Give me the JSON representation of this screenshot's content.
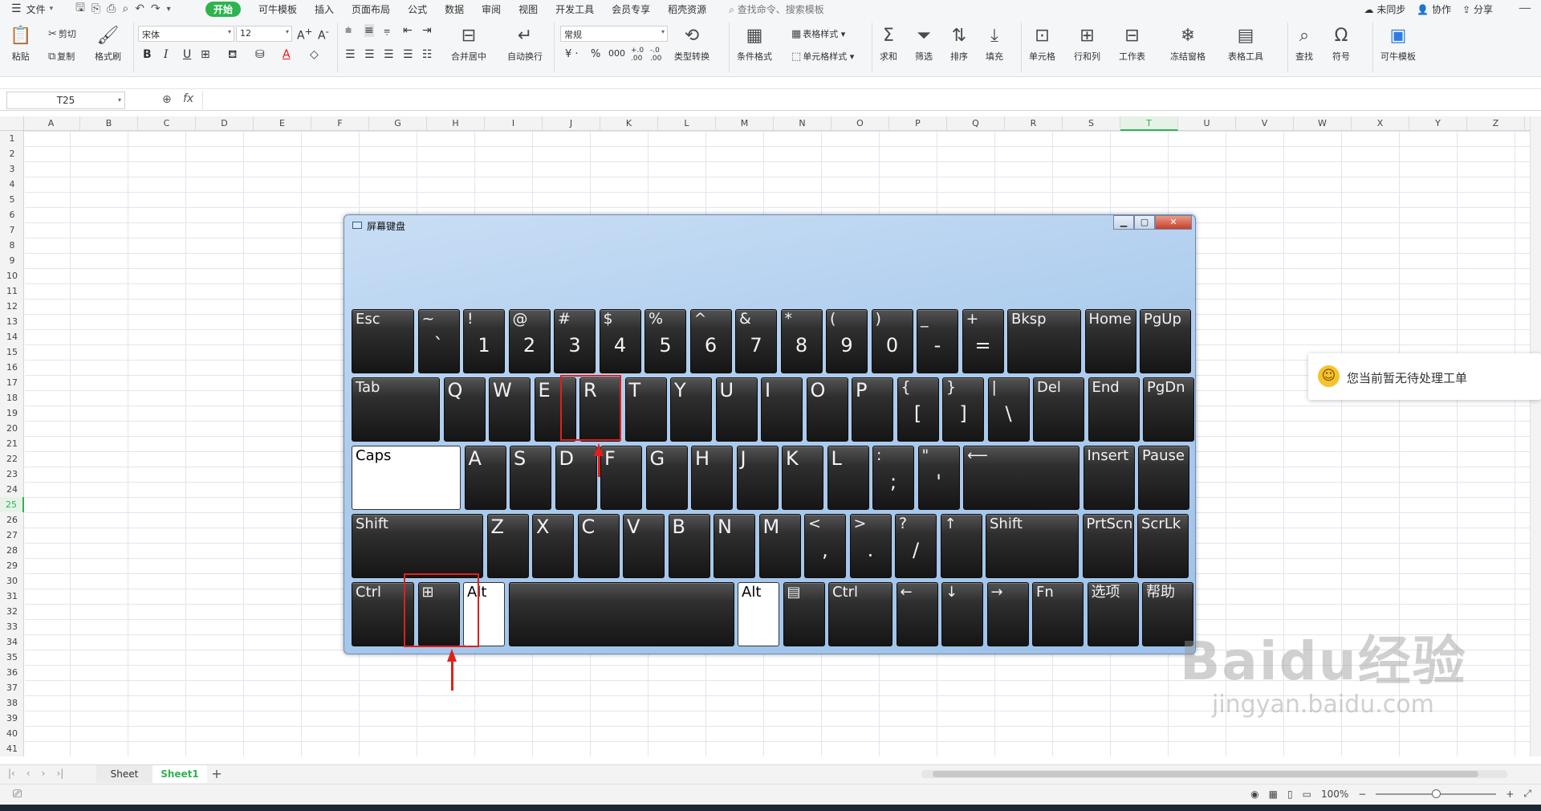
{
  "menu": {
    "file_label": "文件",
    "tabs": [
      "开始",
      "可牛模板",
      "插入",
      "页面布局",
      "公式",
      "数据",
      "审阅",
      "视图",
      "开发工具",
      "会员专享",
      "稻壳资源"
    ],
    "search_label": "查找命令、搜索模板",
    "right": [
      "未同步",
      "协作",
      "分享"
    ]
  },
  "ribbon": {
    "paste": "粘贴",
    "cut": "剪切",
    "copy": "复制",
    "format_painter": "格式刷",
    "font_name": "宋体",
    "font_size": "12",
    "merge_center": "合并居中",
    "wrap_text": "自动换行",
    "number_format": "常规",
    "type_convert": "类型转换",
    "cond_format": "条件格式",
    "table_style": "表格样式",
    "cell_style": "单元格样式",
    "sum": "求和",
    "filter": "筛选",
    "sort": "排序",
    "fill": "填充",
    "cell": "单元格",
    "row_col": "行和列",
    "worksheet": "工作表",
    "freeze": "冻结窗格",
    "table_tools": "表格工具",
    "find": "查找",
    "symbol": "符号",
    "kn_template": "可牛模板"
  },
  "formula": {
    "name_box": "T25",
    "fx": "fx",
    "value": ""
  },
  "grid": {
    "columns": [
      "A",
      "B",
      "C",
      "D",
      "E",
      "F",
      "G",
      "H",
      "I",
      "J",
      "K",
      "L",
      "M",
      "N",
      "O",
      "P",
      "Q",
      "R",
      "S",
      "T",
      "U",
      "V",
      "W",
      "X",
      "Y",
      "Z"
    ],
    "selected_column": "T",
    "selected_row": "25",
    "rows": [
      "1",
      "2",
      "3",
      "4",
      "5",
      "6",
      "7",
      "8",
      "9",
      "10",
      "11",
      "12",
      "13",
      "14",
      "15",
      "16",
      "17",
      "18",
      "19",
      "20",
      "21",
      "22",
      "23",
      "24",
      "25",
      "26",
      "27",
      "28",
      "29",
      "30",
      "31",
      "32",
      "33",
      "34",
      "35",
      "36",
      "37",
      "38",
      "39",
      "40",
      "41"
    ]
  },
  "sheets": {
    "tabs": [
      "Sheet",
      "Sheet1"
    ],
    "active": "Sheet1",
    "add": "+"
  },
  "status": {
    "zoom": "100%"
  },
  "notification": {
    "text": "您当前暂无待处理工单"
  },
  "osk": {
    "title": "屏幕键盘",
    "rows": [
      [
        {
          "t": "Esc",
          "b": ""
        },
        {
          "t": "~",
          "b": "`"
        },
        {
          "t": "!",
          "b": "1"
        },
        {
          "t": "@",
          "b": "2"
        },
        {
          "t": "#",
          "b": "3"
        },
        {
          "t": "$",
          "b": "4"
        },
        {
          "t": "%",
          "b": "5"
        },
        {
          "t": "^",
          "b": "6"
        },
        {
          "t": "&",
          "b": "7"
        },
        {
          "t": "*",
          "b": "8"
        },
        {
          "t": "(",
          "b": "9"
        },
        {
          "t": ")",
          "b": "0"
        },
        {
          "t": "_",
          "b": "-"
        },
        {
          "t": "+",
          "b": "="
        },
        {
          "t": "Bksp",
          "b": ""
        },
        {
          "t": "Home",
          "b": ""
        },
        {
          "t": "PgUp",
          "b": ""
        }
      ],
      [
        {
          "t": "Tab",
          "b": ""
        },
        {
          "t": "Q",
          "b": ""
        },
        {
          "t": "W",
          "b": ""
        },
        {
          "t": "E",
          "b": ""
        },
        {
          "t": "R",
          "b": ""
        },
        {
          "t": "T",
          "b": ""
        },
        {
          "t": "Y",
          "b": ""
        },
        {
          "t": "U",
          "b": ""
        },
        {
          "t": "I",
          "b": ""
        },
        {
          "t": "O",
          "b": ""
        },
        {
          "t": "P",
          "b": ""
        },
        {
          "t": "{",
          "b": "["
        },
        {
          "t": "}",
          "b": "]"
        },
        {
          "t": "|",
          "b": "\\"
        },
        {
          "t": "Del",
          "b": ""
        },
        {
          "t": "End",
          "b": ""
        },
        {
          "t": "PgDn",
          "b": ""
        }
      ],
      [
        {
          "t": "Caps",
          "b": ""
        },
        {
          "t": "A",
          "b": ""
        },
        {
          "t": "S",
          "b": ""
        },
        {
          "t": "D",
          "b": ""
        },
        {
          "t": "F",
          "b": ""
        },
        {
          "t": "G",
          "b": ""
        },
        {
          "t": "H",
          "b": ""
        },
        {
          "t": "J",
          "b": ""
        },
        {
          "t": "K",
          "b": ""
        },
        {
          "t": "L",
          "b": ""
        },
        {
          "t": ":",
          "b": ";"
        },
        {
          "t": "\"",
          "b": "'"
        },
        {
          "t": "⟵",
          "b": ""
        },
        {
          "t": "Insert",
          "b": ""
        },
        {
          "t": "Pause",
          "b": ""
        }
      ],
      [
        {
          "t": "Shift",
          "b": ""
        },
        {
          "t": "Z",
          "b": ""
        },
        {
          "t": "X",
          "b": ""
        },
        {
          "t": "C",
          "b": ""
        },
        {
          "t": "V",
          "b": ""
        },
        {
          "t": "B",
          "b": ""
        },
        {
          "t": "N",
          "b": ""
        },
        {
          "t": "M",
          "b": ""
        },
        {
          "t": "<",
          "b": ","
        },
        {
          "t": ">",
          "b": "."
        },
        {
          "t": "?",
          "b": "/"
        },
        {
          "t": "↑",
          "b": ""
        },
        {
          "t": "Shift",
          "b": ""
        },
        {
          "t": "PrtScn",
          "b": ""
        },
        {
          "t": "ScrLk",
          "b": ""
        }
      ],
      [
        {
          "t": "Ctrl",
          "b": ""
        },
        {
          "t": "⊞",
          "b": ""
        },
        {
          "t": "Alt",
          "b": ""
        },
        {
          "t": "",
          "b": ""
        },
        {
          "t": "Alt",
          "b": ""
        },
        {
          "t": "▤",
          "b": ""
        },
        {
          "t": "Ctrl",
          "b": ""
        },
        {
          "t": "←",
          "b": ""
        },
        {
          "t": "↓",
          "b": ""
        },
        {
          "t": "→",
          "b": ""
        },
        {
          "t": "Fn",
          "b": ""
        },
        {
          "t": "选项",
          "b": ""
        },
        {
          "t": "帮助",
          "b": ""
        }
      ]
    ]
  },
  "watermark": {
    "line1": "Baidu经验",
    "line2": "jingyan.baidu.com"
  }
}
